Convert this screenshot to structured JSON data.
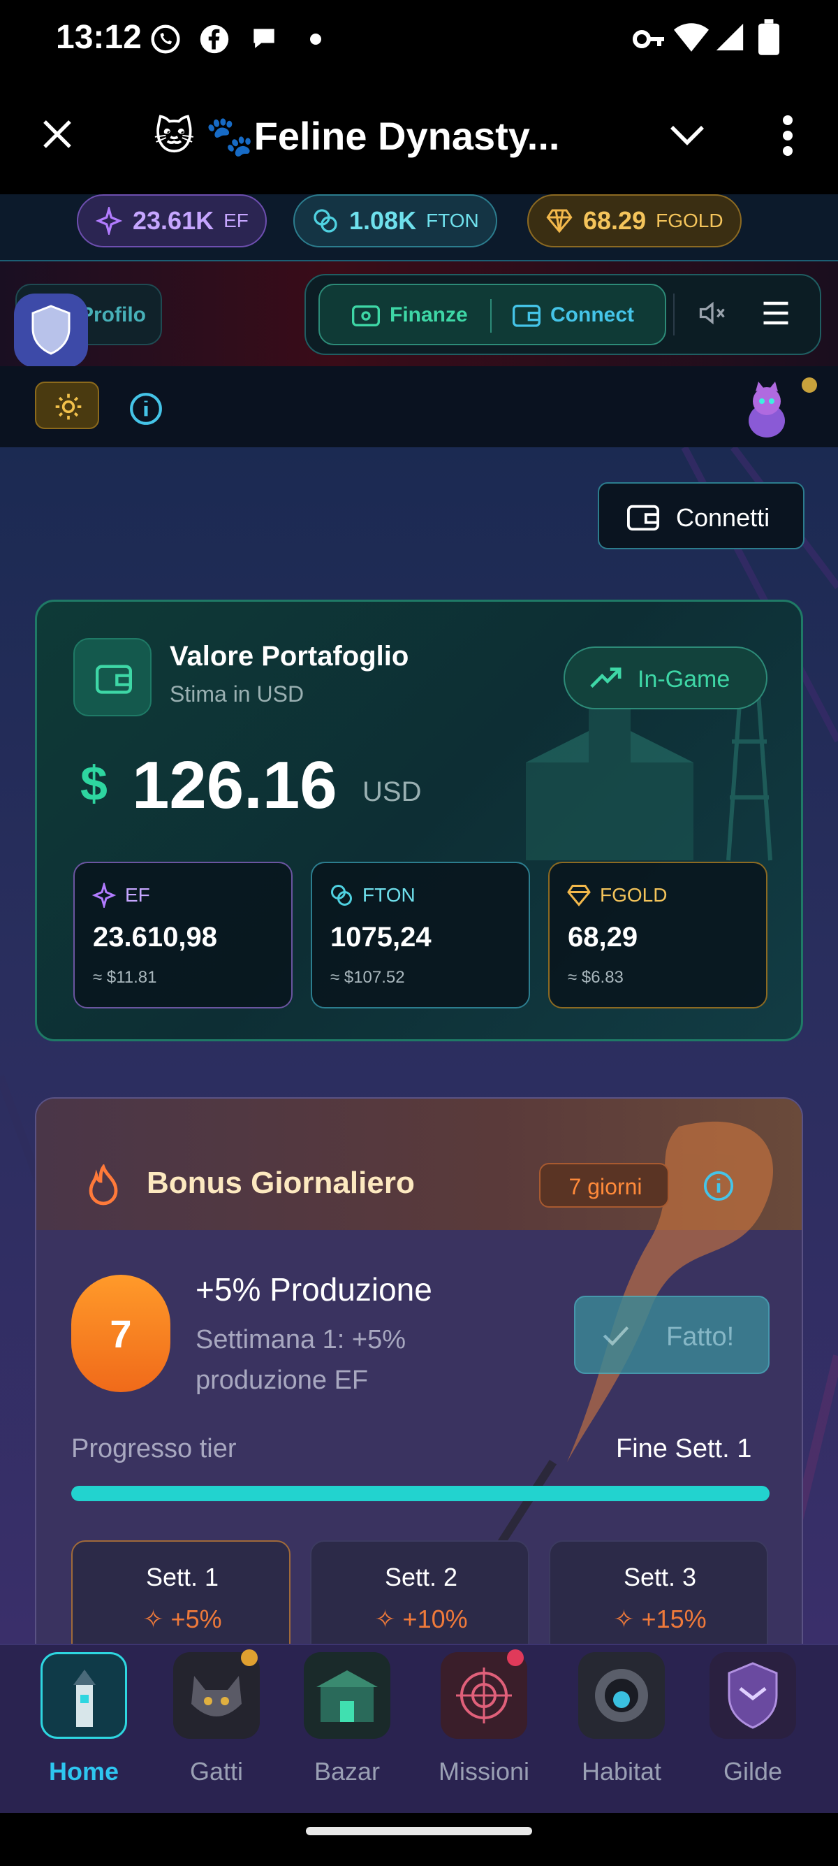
{
  "status_bar": {
    "time": "13:12"
  },
  "app_bar": {
    "title": "🐱 🐾Feline Dynasty..."
  },
  "currency": [
    {
      "value": "23.61K",
      "unit": "EF",
      "color": "#b27cff"
    },
    {
      "value": "1.08K",
      "unit": "FTON",
      "color": "#4fd1e0"
    },
    {
      "value": "68.29",
      "unit": "FGOLD",
      "color": "#f2b84b"
    }
  ],
  "header": {
    "profile_label": "Profilo",
    "finanze_label": "Finanze",
    "connect_label": "Connect"
  },
  "connetti_button": "Connetti",
  "portfolio": {
    "title": "Valore Portafoglio",
    "subtitle": "Stima in USD",
    "badge": "In-Game",
    "currency_symbol": "$",
    "amount": "126.16",
    "unit": "USD",
    "assets": [
      {
        "name": "EF",
        "value": "23.610,98",
        "usd": "≈ $11.81",
        "color": "#b27cff"
      },
      {
        "name": "FTON",
        "value": "1075,24",
        "usd": "≈ $107.52",
        "color": "#4fd1e0"
      },
      {
        "name": "FGOLD",
        "value": "68,29",
        "usd": "≈ $6.83",
        "color": "#f2b84b"
      }
    ]
  },
  "bonus": {
    "title": "Bonus Giornaliero",
    "days_badge": "7 giorni",
    "day_number": "7",
    "headline": "+5% Produzione",
    "desc": "Settimana 1: +5% produzione EF",
    "done_button": "Fatto!",
    "progress_label": "Progresso tier",
    "progress_end": "Fine Sett. 1",
    "progress": 1.0,
    "weeks": [
      {
        "label": "Sett. 1",
        "bonus": "+5%"
      },
      {
        "label": "Sett. 2",
        "bonus": "+10%"
      },
      {
        "label": "Sett. 3",
        "bonus": "+15%"
      }
    ]
  },
  "nav": [
    {
      "label": "Home",
      "active": true
    },
    {
      "label": "Gatti",
      "active": false
    },
    {
      "label": "Bazar",
      "active": false
    },
    {
      "label": "Missioni",
      "active": false
    },
    {
      "label": "Habitat",
      "active": false
    },
    {
      "label": "Gilde",
      "active": false
    }
  ]
}
